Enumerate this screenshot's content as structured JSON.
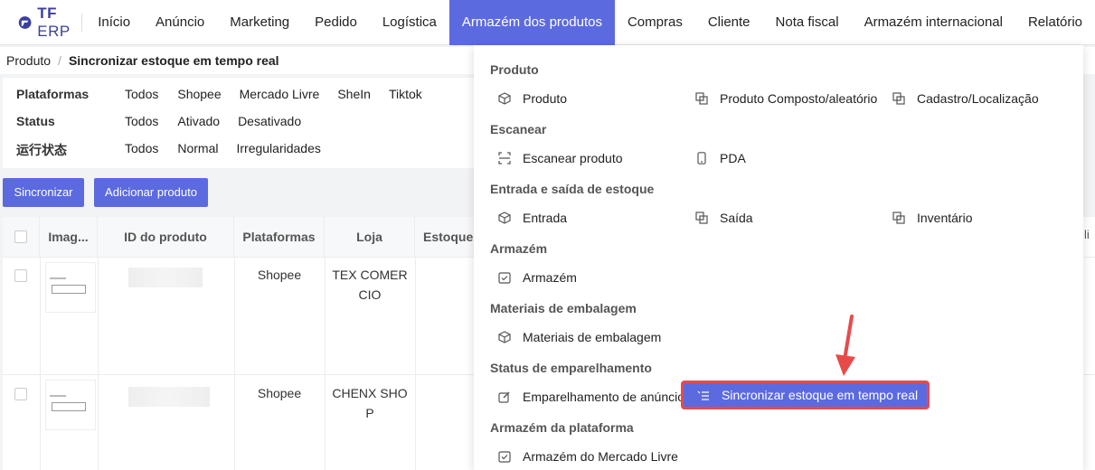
{
  "brand": {
    "bold": "TF",
    "rest": " ERP"
  },
  "nav": [
    {
      "label": "Início"
    },
    {
      "label": "Anúncio"
    },
    {
      "label": "Marketing"
    },
    {
      "label": "Pedido"
    },
    {
      "label": "Logística"
    },
    {
      "label": "Armazém dos produtos",
      "active": true
    },
    {
      "label": "Compras"
    },
    {
      "label": "Cliente"
    },
    {
      "label": "Nota fiscal"
    },
    {
      "label": "Armazém internacional"
    },
    {
      "label": "Relatório"
    }
  ],
  "breadcrumb": {
    "root": "Produto",
    "current": "Sincronizar estoque em tempo real"
  },
  "filters": {
    "plataformas": {
      "label": "Plataformas",
      "options": [
        "Todos",
        "Shopee",
        "Mercado Livre",
        "SheIn",
        "Tiktok"
      ]
    },
    "status": {
      "label": "Status",
      "options": [
        "Todos",
        "Ativado",
        "Desativado"
      ]
    },
    "run_status": {
      "label": "运行状态",
      "options": [
        "Todos",
        "Normal",
        "Irregularidades"
      ]
    }
  },
  "buttons": {
    "sync": "Sincronizar",
    "add": "Adicionar produto"
  },
  "table": {
    "headers": [
      "Imag...",
      "ID do produto",
      "Plataformas",
      "Loja",
      "Estoque d"
    ],
    "rows": [
      {
        "platform": "Shopee",
        "store_line1": "TEX COMER",
        "store_line2": "CIO"
      },
      {
        "platform": "Shopee",
        "store_line1": "CHENX SHO",
        "store_line2": "P"
      }
    ]
  },
  "menu": {
    "sections": [
      {
        "title": "Produto",
        "items": [
          "Produto",
          "Produto Composto/aleatório",
          "Cadastro/Localização"
        ]
      },
      {
        "title": "Escanear",
        "items": [
          "Escanear produto",
          "PDA"
        ]
      },
      {
        "title": "Entrada e saída de estoque",
        "items": [
          "Entrada",
          "Saída",
          "Inventário"
        ]
      },
      {
        "title": "Armazém",
        "items": [
          "Armazém"
        ]
      },
      {
        "title": "Materiais de embalagem",
        "items": [
          "Materiais de embalagem"
        ]
      },
      {
        "title": "Status de emparelhamento",
        "items": [
          "Emparelhamento de anúncios",
          "Sincronizar estoque em tempo real"
        ]
      },
      {
        "title": "Armazém da plataforma",
        "items": [
          "Armazém do Mercado Livre"
        ]
      }
    ]
  },
  "colors": {
    "accent": "#5c6ae0",
    "highlight_border": "#e84a4a",
    "arrow": "#e84a4a"
  }
}
